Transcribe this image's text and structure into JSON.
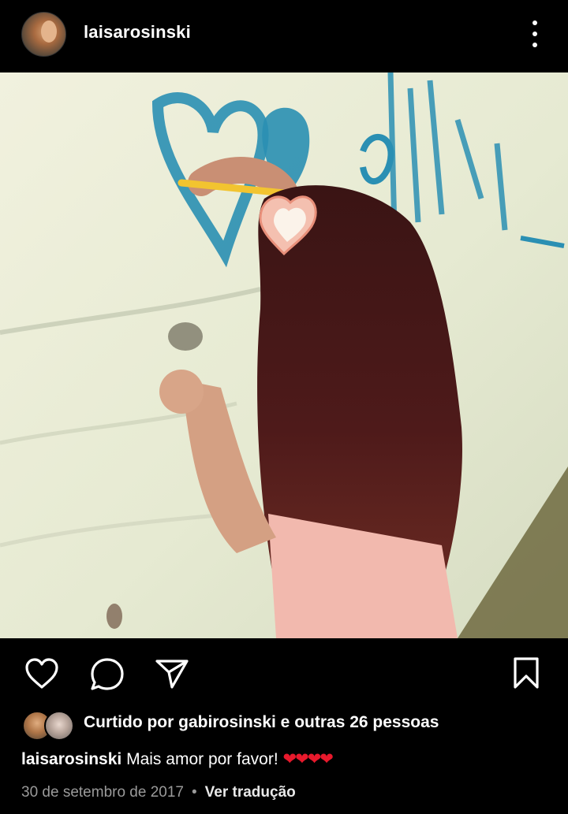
{
  "header": {
    "username": "laisarosinski",
    "more_icon": "more-vertical-icon"
  },
  "post": {
    "image_subject": "photo",
    "actions": {
      "like_icon": "heart-icon",
      "comment_icon": "comment-icon",
      "share_icon": "send-icon",
      "save_icon": "bookmark-icon"
    },
    "likes_text": "Curtido por gabirosinski e outras 26 pessoas",
    "caption_user": "laisarosinski",
    "caption_text": "Mais amor por favor!",
    "caption_hearts": "❤❤❤❤",
    "date": "30 de setembro de 2017",
    "separator": "•",
    "translate_label": "Ver tradução"
  },
  "colors": {
    "background": "#000000",
    "text": "#ffffff",
    "muted": "#9a9a9a",
    "heart_red": "#e8192c"
  }
}
